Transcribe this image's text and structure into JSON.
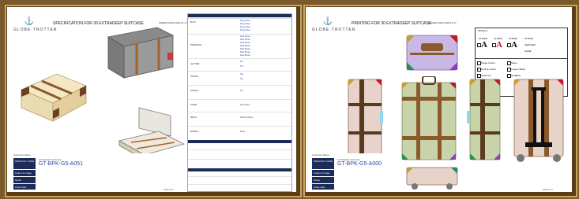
{
  "brand": {
    "name": "GLOBE·TROTTER"
  },
  "left": {
    "title": "SPECIFICATION FOR 30 EXTRADEEP SUITCASE",
    "order_ref": "ORDER DATE 2018-12-17",
    "spec": {
      "sections": [
        {
          "label": "BODY",
          "values": [
            "Dusty Rose",
            "Dusty Rose",
            "Dusty Rose",
            "Dusty Rose"
          ]
        },
        {
          "label": "TRIMMINGS",
          "values": [
            "Dark Brown",
            "Dark Brown",
            "Dark Brown",
            "Dark Brown",
            "Dark Brown",
            "Dark Brown",
            "Dark Brown"
          ]
        },
        {
          "label": "LEATHER",
          "values": [
            "Tan",
            "Tan"
          ]
        },
        {
          "label": "STRAPS",
          "values": [
            "Tan",
            "Tan"
          ]
        },
        {
          "label": "HANDLE",
          "values": [
            "Tan"
          ]
        },
        {
          "label": "LINING",
          "values": [
            "Pink Stripe"
          ]
        },
        {
          "label": "METAL",
          "values": [
            "Polished Brass"
          ]
        },
        {
          "label": "WHEELS",
          "values": [
            "Black"
          ]
        }
      ]
    },
    "customer": {
      "heading": "Customer Name",
      "rows": [
        {
          "label": "PRODUCT CODE",
          "code": "GT-BPK-G5-A051",
          "sub": "EXTRADEEP SUITCASE"
        },
        {
          "label": "Colour & Image",
          "code": "",
          "sub": ""
        },
        {
          "label": "Name",
          "code": "",
          "sub": ""
        },
        {
          "label": "Order date",
          "code": "",
          "sub": ""
        }
      ]
    },
    "footer": "2018-12-17"
  },
  "right": {
    "title": "PRINTING FOR 30 EXTRADEEP SUITCASE",
    "order_ref": "ORDER DATE 2018-12-17",
    "decals": {
      "heading": "INITIALS",
      "letters": [
        "A",
        "A",
        "A"
      ],
      "letter_colors": [
        "#111111",
        "#c0182a",
        "#111111"
      ],
      "captions": [
        "STRIPE",
        "STRIPE",
        "STRIPE"
      ],
      "options": [
        "STRIPE",
        "FEATHER",
        "NAME",
        "Single Colour",
        "Double Colour",
        "Gold Foil",
        "Stone",
        "Copper Black",
        "Red/Blue"
      ]
    },
    "customer": {
      "heading": "Customer Name",
      "rows": [
        {
          "label": "PRODUCT CODE",
          "code": "GT-BPK-G5-A000",
          "sub": "EXTRADEEP SUITCASE"
        },
        {
          "label": "Colour & Image",
          "code": "",
          "sub": ""
        },
        {
          "label": "Name",
          "code": "",
          "sub": ""
        },
        {
          "label": "Order date",
          "code": "",
          "sub": ""
        }
      ]
    },
    "footer": "2018-12-17"
  },
  "colors": {
    "frame": "#5a3e1a",
    "navy": "#1c2b57",
    "cream": "#f3e7c4",
    "sage": "#c9d3a9",
    "rose": "#e7d3c9",
    "tan": "#b07a3a",
    "dark_brown": "#5a3a1f",
    "lavender": "#c9b7e6",
    "sky_blue": "#8fd6f0"
  }
}
